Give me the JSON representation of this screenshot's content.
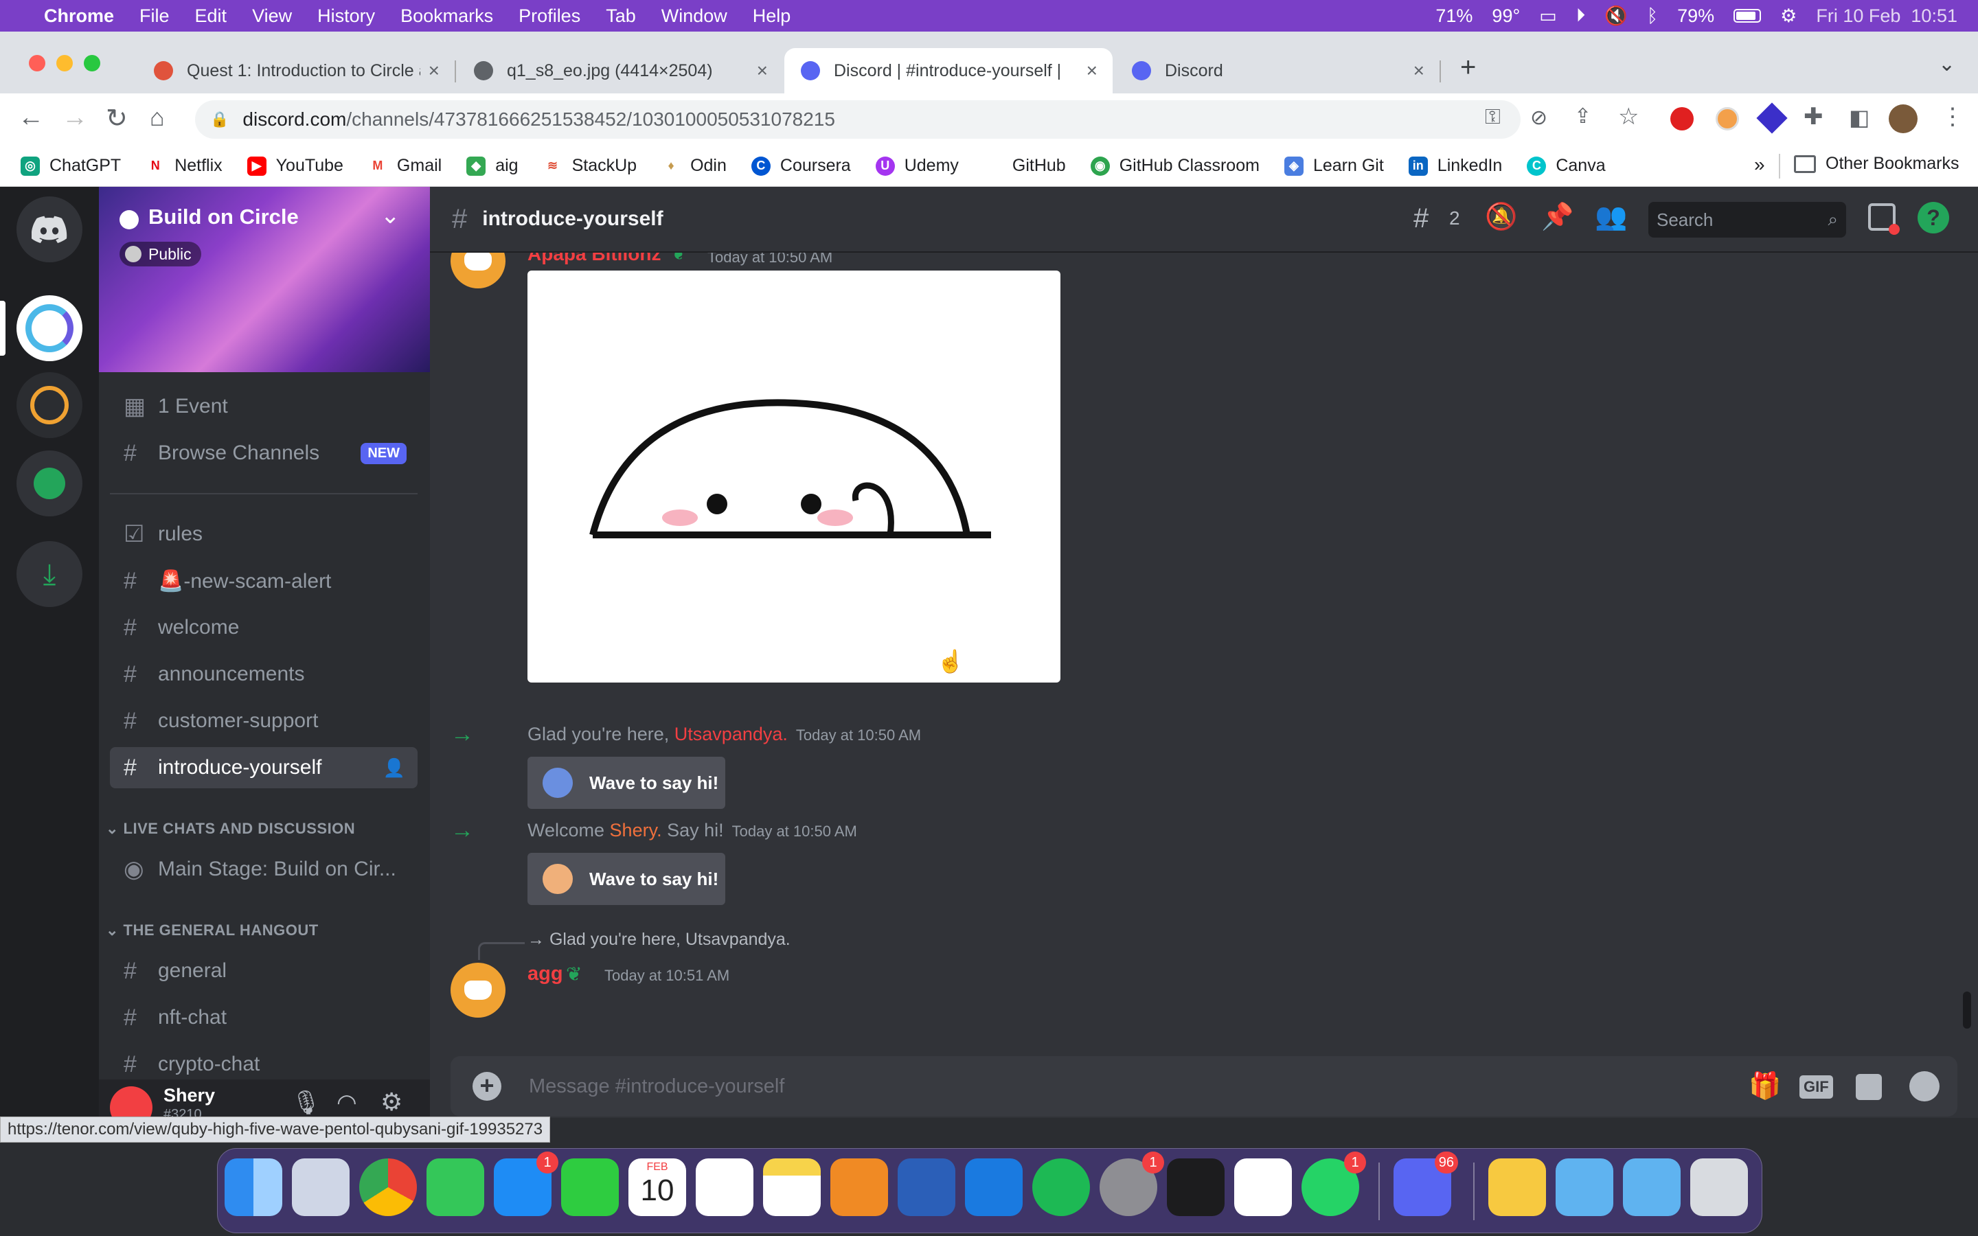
{
  "menubar": {
    "app": "Chrome",
    "items": [
      "File",
      "Edit",
      "View",
      "History",
      "Bookmarks",
      "Profiles",
      "Tab",
      "Window",
      "Help"
    ],
    "cpu": "71%",
    "temp": "99°",
    "battery": "79%",
    "datetime": "Fri 10 Feb  10:51"
  },
  "tabs": [
    {
      "title": "Quest 1: Introduction to Circle a",
      "icon_color": "#e0533c"
    },
    {
      "title": "q1_s8_eo.jpg (4414×2504)",
      "icon_color": "#5f6368"
    },
    {
      "title": "Discord | #introduce-yourself |",
      "icon_color": "#5865f2"
    },
    {
      "title": "Discord",
      "icon_color": "#5865f2"
    }
  ],
  "omnibox": {
    "domain": "discord.com",
    "path": "/channels/473781666251538452/1030100050531078215"
  },
  "bookmarks": [
    {
      "label": "ChatGPT",
      "color": "#10a37f",
      "glyph": "◎"
    },
    {
      "label": "Netflix",
      "color": "#e50914",
      "glyph": "N"
    },
    {
      "label": "YouTube",
      "color": "#ff0000",
      "glyph": "▶"
    },
    {
      "label": "Gmail",
      "color": "#ea4335",
      "glyph": "M"
    },
    {
      "label": "aig",
      "color": "#34a853",
      "glyph": "◆"
    },
    {
      "label": "StackUp",
      "color": "#e0533c",
      "glyph": "≋"
    },
    {
      "label": "Odin",
      "color": "#c59b4f",
      "glyph": "♦"
    },
    {
      "label": "Coursera",
      "color": "#0056d2",
      "glyph": "C"
    },
    {
      "label": "Udemy",
      "color": "#a435f0",
      "glyph": "U"
    },
    {
      "label": "GitHub",
      "color": "#ffffff",
      "glyph": ""
    },
    {
      "label": "GitHub Classroom",
      "color": "#2da44e",
      "glyph": "◉"
    },
    {
      "label": "Learn Git",
      "color": "#4a7de0",
      "glyph": "◈"
    },
    {
      "label": "LinkedIn",
      "color": "#0a66c2",
      "glyph": "in"
    },
    {
      "label": "Canva",
      "color": "#00c4cc",
      "glyph": "C"
    }
  ],
  "bookmarks_more": "»",
  "other_bookmarks": "Other Bookmarks",
  "server": {
    "name": "Build on Circle",
    "visibility": "Public"
  },
  "sidebar": {
    "event": "1 Event",
    "browse": "Browse Channels",
    "new_badge": "NEW",
    "channels": [
      "rules",
      "🚨-new-scam-alert",
      "welcome",
      "announcements",
      "customer-support",
      "introduce-yourself"
    ],
    "cat1": "LIVE CHATS AND DISCUSSION",
    "stage": "Main Stage: Build on Cir...",
    "cat2": "THE GENERAL HANGOUT",
    "channels2": [
      "general",
      "nft-chat",
      "crypto-chat"
    ]
  },
  "user": {
    "name": "Shery",
    "tag": "#3210"
  },
  "header": {
    "channel": "introduce-yourself",
    "threads": "2",
    "search": "Search"
  },
  "messages": {
    "top_author": "Apapa Bitlionz",
    "top_time": "Today at 10:50 AM",
    "sys1_prefix": "Glad you're here, ",
    "sys1_name": "Utsavpandya.",
    "sys1_time": "Today at 10:50 AM",
    "wave_label": "Wave to say hi!",
    "sys2_prefix": "Welcome ",
    "sys2_name": "Shery.",
    "sys2_suffix": " Say hi!",
    "sys2_time": "Today at 10:50 AM",
    "reply_ref": "→ Glad you're here, Utsavpandya.",
    "agg_author": "agg",
    "agg_time": "Today at 10:51 AM"
  },
  "composer": {
    "placeholder": "Message #introduce-yourself",
    "gif": "GIF"
  },
  "status_url": "https://tenor.com/view/quby-high-five-wave-pentol-qubysani-gif-19935273",
  "dock": {
    "mail_badge": "1",
    "settings_badge": "1",
    "whatsapp_badge": "1",
    "discord_badge": "96",
    "calendar_month": "FEB",
    "calendar_day": "10"
  }
}
